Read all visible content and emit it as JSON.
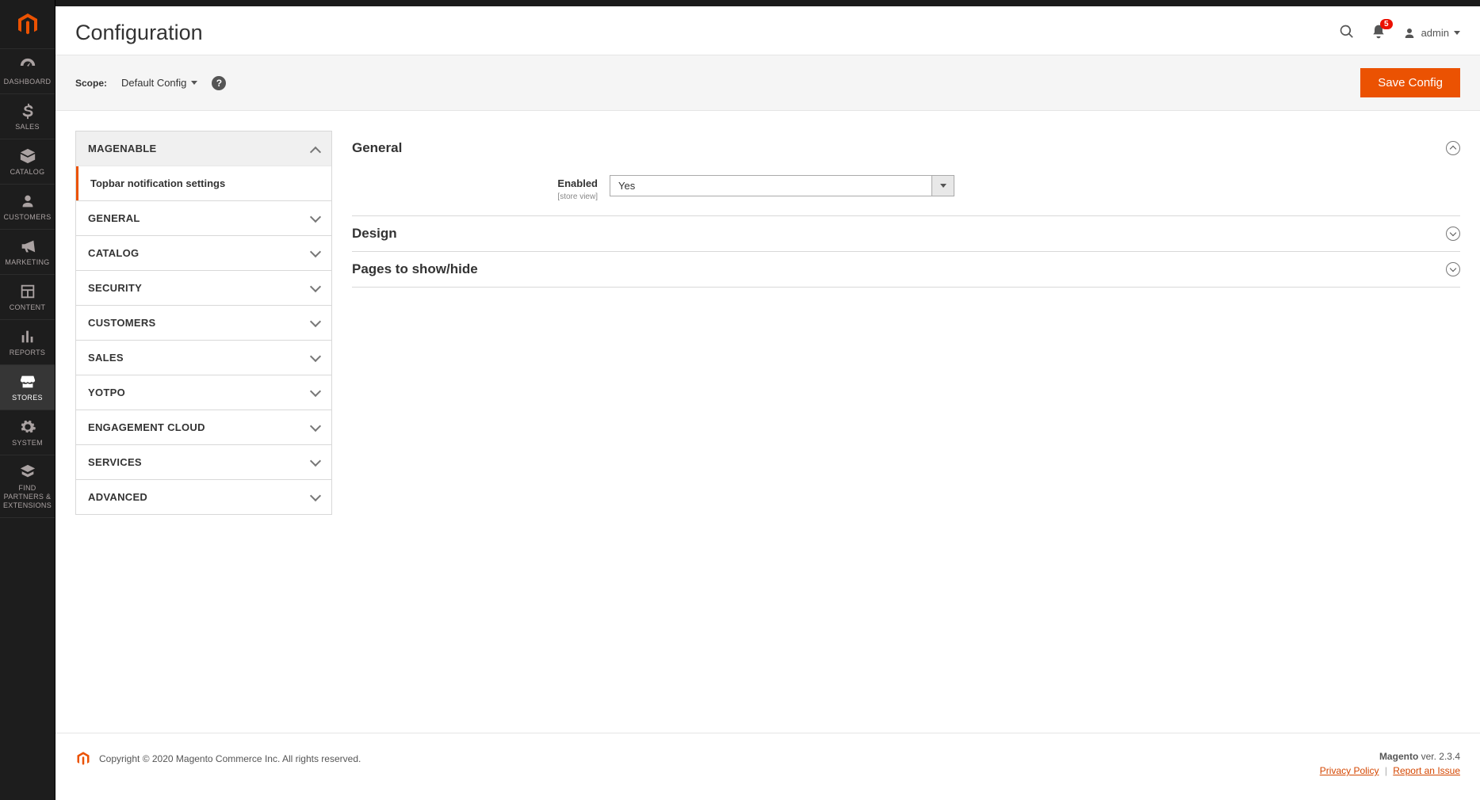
{
  "page_title": "Configuration",
  "notifications_count": "5",
  "user_label": "admin",
  "scope": {
    "label": "Scope:",
    "value": "Default Config"
  },
  "save_button": "Save Config",
  "nav": [
    {
      "key": "dashboard",
      "label": "DASHBOARD"
    },
    {
      "key": "sales",
      "label": "SALES"
    },
    {
      "key": "catalog",
      "label": "CATALOG"
    },
    {
      "key": "customers",
      "label": "CUSTOMERS"
    },
    {
      "key": "marketing",
      "label": "MARKETING"
    },
    {
      "key": "content",
      "label": "CONTENT"
    },
    {
      "key": "reports",
      "label": "REPORTS"
    },
    {
      "key": "stores",
      "label": "STORES",
      "active": true
    },
    {
      "key": "system",
      "label": "SYSTEM"
    },
    {
      "key": "partners",
      "label": "FIND PARTNERS & EXTENSIONS"
    }
  ],
  "config_groups": [
    {
      "label": "MAGENABLE",
      "expanded": true,
      "items": [
        {
          "label": "Topbar notification settings",
          "active": true
        }
      ]
    },
    {
      "label": "GENERAL"
    },
    {
      "label": "CATALOG"
    },
    {
      "label": "SECURITY"
    },
    {
      "label": "CUSTOMERS"
    },
    {
      "label": "SALES"
    },
    {
      "label": "YOTPO"
    },
    {
      "label": "ENGAGEMENT CLOUD"
    },
    {
      "label": "SERVICES"
    },
    {
      "label": "ADVANCED"
    }
  ],
  "sections": {
    "general": {
      "title": "General",
      "field_enabled_label": "Enabled",
      "field_enabled_scope": "[store view]",
      "field_enabled_value": "Yes"
    },
    "design": {
      "title": "Design"
    },
    "pages": {
      "title": "Pages to show/hide"
    }
  },
  "footer": {
    "copyright": "Copyright © 2020 Magento Commerce Inc. All rights reserved.",
    "product": "Magento",
    "version": "ver. 2.3.4",
    "privacy": "Privacy Policy",
    "report": "Report an Issue"
  }
}
